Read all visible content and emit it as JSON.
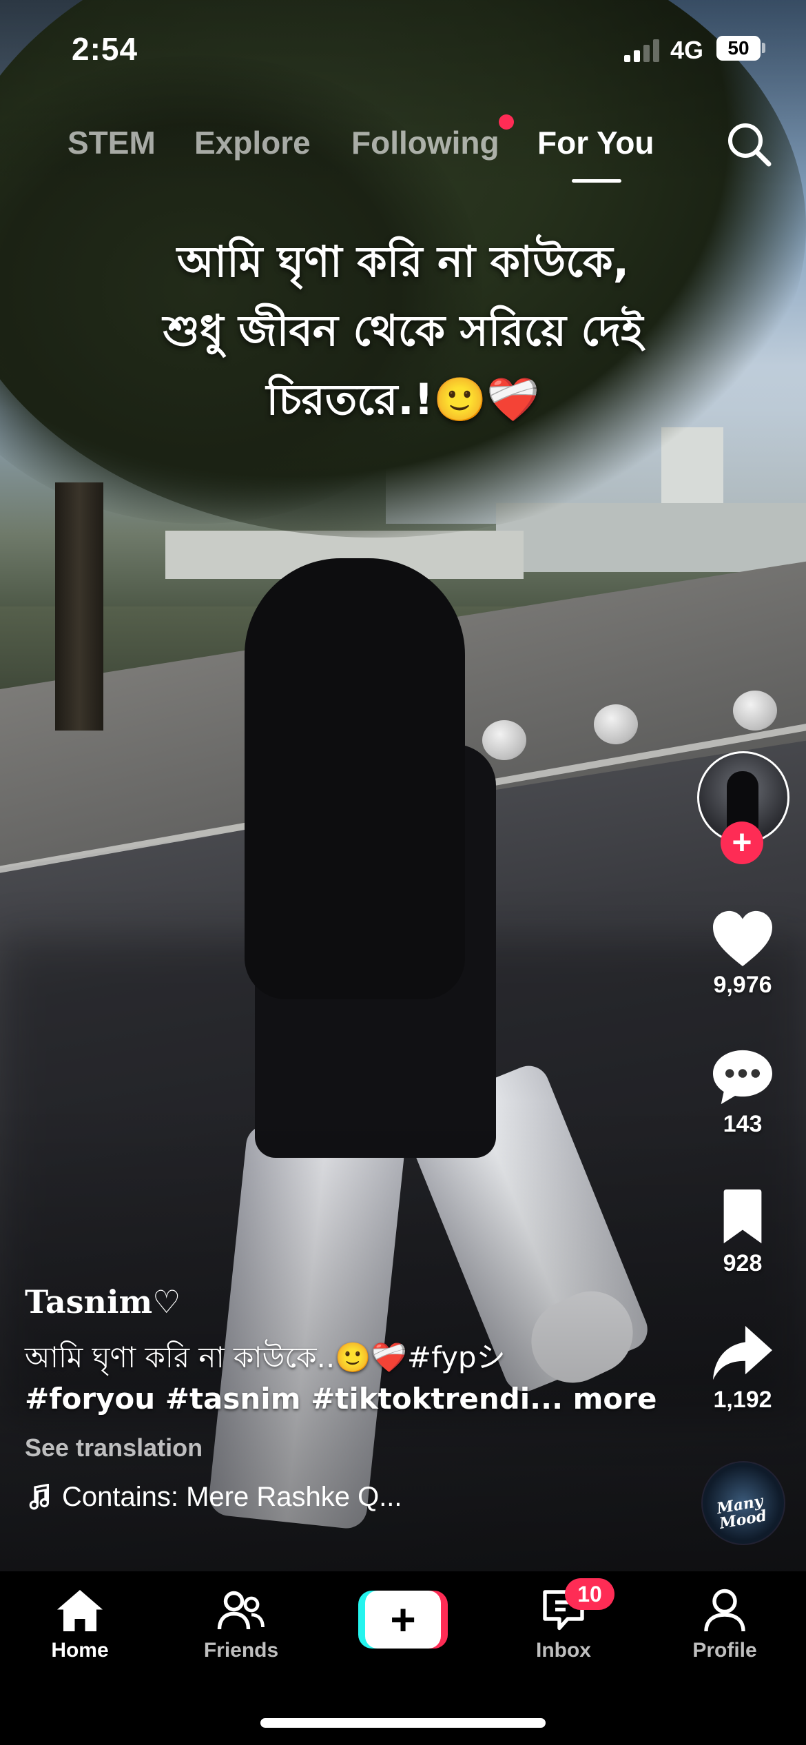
{
  "status_bar": {
    "time": "2:54",
    "network": "4G",
    "battery": "50"
  },
  "top_tabs": [
    {
      "label": "STEM",
      "active": false
    },
    {
      "label": "Explore",
      "active": false
    },
    {
      "label": "Following",
      "active": false,
      "has_dot": true
    },
    {
      "label": "For You",
      "active": true
    }
  ],
  "caption": {
    "line1": "আমি ঘৃণা করি না কাউকে,",
    "line2": "শুধু জীবন থেকে সরিয়ে দেই",
    "line3": "চিরতরে.!🙂❤️‍🩹"
  },
  "actions": {
    "likes": "9,976",
    "comments": "143",
    "saves": "928",
    "shares": "1,192"
  },
  "music_disc_text": "Many Mood",
  "post": {
    "username": "Tasnim♡",
    "description_line1": "আমি ঘৃণা করি না কাউকে..🙂❤️‍🩹#fypシ",
    "description_line2": "#foryou #tasnim #tiktoktrendi...",
    "more": "more",
    "see_translation": "See translation",
    "sound": "Contains: Mere Rashke Q..."
  },
  "bottom_nav": {
    "home": "Home",
    "friends": "Friends",
    "inbox": "Inbox",
    "inbox_badge": "10",
    "profile": "Profile"
  },
  "colors": {
    "accent": "#fe2c55",
    "cyan": "#25f4ee"
  }
}
